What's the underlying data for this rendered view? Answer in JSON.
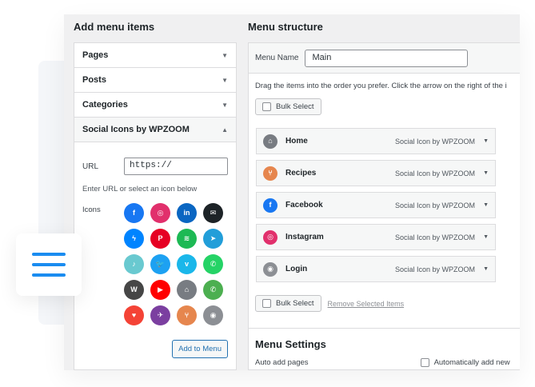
{
  "left": {
    "title": "Add menu items",
    "sections": [
      {
        "label": "Pages"
      },
      {
        "label": "Posts"
      },
      {
        "label": "Categories"
      },
      {
        "label": "Social Icons by WPZOOM"
      }
    ],
    "url_label": "URL",
    "url_value": "https://",
    "hint": "Enter URL or select an icon below",
    "icons_label": "Icons",
    "icons": [
      {
        "name": "facebook-icon",
        "color": "#1877f2",
        "glyph": "f"
      },
      {
        "name": "instagram-icon",
        "color": "#e1306c",
        "glyph": "◎"
      },
      {
        "name": "linkedin-icon",
        "color": "#0a66c2",
        "glyph": "in"
      },
      {
        "name": "email-icon",
        "color": "#1d2327",
        "glyph": "✉"
      },
      {
        "name": "messenger-icon",
        "color": "#0084ff",
        "glyph": "ϟ"
      },
      {
        "name": "pinterest-icon",
        "color": "#e60023",
        "glyph": "P"
      },
      {
        "name": "spotify-icon",
        "color": "#1db954",
        "glyph": "≋"
      },
      {
        "name": "telegram-icon",
        "color": "#229ed9",
        "glyph": "➤"
      },
      {
        "name": "tiktok-icon",
        "color": "#69c9d0",
        "glyph": "♪"
      },
      {
        "name": "twitter-icon",
        "color": "#1da1f2",
        "glyph": "🐦"
      },
      {
        "name": "vimeo-icon",
        "color": "#1ab7ea",
        "glyph": "v"
      },
      {
        "name": "whatsapp-icon",
        "color": "#25d366",
        "glyph": "✆"
      },
      {
        "name": "wordpress-icon",
        "color": "#464646",
        "glyph": "W"
      },
      {
        "name": "youtube-icon",
        "color": "#ff0000",
        "glyph": "▶"
      },
      {
        "name": "home-icon",
        "color": "#787c82",
        "glyph": "⌂"
      },
      {
        "name": "phone-icon",
        "color": "#4caf50",
        "glyph": "✆"
      },
      {
        "name": "heart-icon",
        "color": "#f44336",
        "glyph": "♥"
      },
      {
        "name": "plane-icon",
        "color": "#7b3fa0",
        "glyph": "✈"
      },
      {
        "name": "restaurant-icon",
        "color": "#e6864e",
        "glyph": "⑂"
      },
      {
        "name": "user-icon",
        "color": "#8c8f94",
        "glyph": "◉"
      }
    ],
    "add_button": "Add to Menu"
  },
  "right": {
    "title": "Menu structure",
    "menu_name_label": "Menu Name",
    "menu_name_value": "Main",
    "instructions": "Drag the items into the order you prefer. Click the arrow on the right of the i",
    "bulk_select": "Bulk Select",
    "items": [
      {
        "title": "Home",
        "type": "Social Icon by WPZOOM",
        "icon": "home-icon",
        "color": "#787c82",
        "glyph": "⌂"
      },
      {
        "title": "Recipes",
        "type": "Social Icon by WPZOOM",
        "icon": "restaurant-icon",
        "color": "#e6864e",
        "glyph": "⑂"
      },
      {
        "title": "Facebook",
        "type": "Social Icon by WPZOOM",
        "icon": "facebook-icon",
        "color": "#1877f2",
        "glyph": "f"
      },
      {
        "title": "Instagram",
        "type": "Social Icon by WPZOOM",
        "icon": "instagram-icon",
        "color": "#e1306c",
        "glyph": "◎"
      },
      {
        "title": "Login",
        "type": "Social Icon by WPZOOM",
        "icon": "user-icon",
        "color": "#8c8f94",
        "glyph": "◉"
      }
    ],
    "bulk_select_bottom": "Bulk Select",
    "remove_selected": "Remove Selected Items",
    "settings_title": "Menu Settings",
    "auto_add_label": "Auto add pages",
    "auto_add_option": "Automatically add new"
  }
}
